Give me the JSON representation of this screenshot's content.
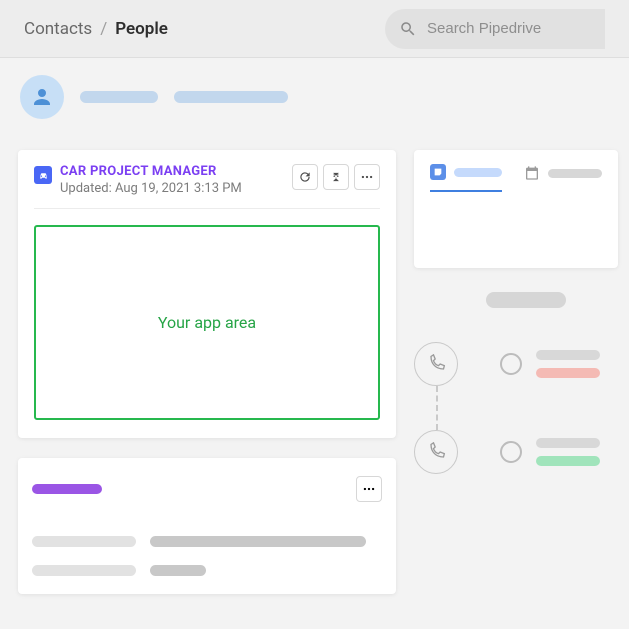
{
  "breadcrumb": {
    "root": "Contacts",
    "sep": "/",
    "current": "People"
  },
  "search": {
    "placeholder": "Search Pipedrive"
  },
  "app_panel": {
    "title": "CAR PROJECT MANAGER",
    "subtitle": "Updated: Aug 19, 2021 3:13 PM",
    "area_text": "Your app area"
  }
}
